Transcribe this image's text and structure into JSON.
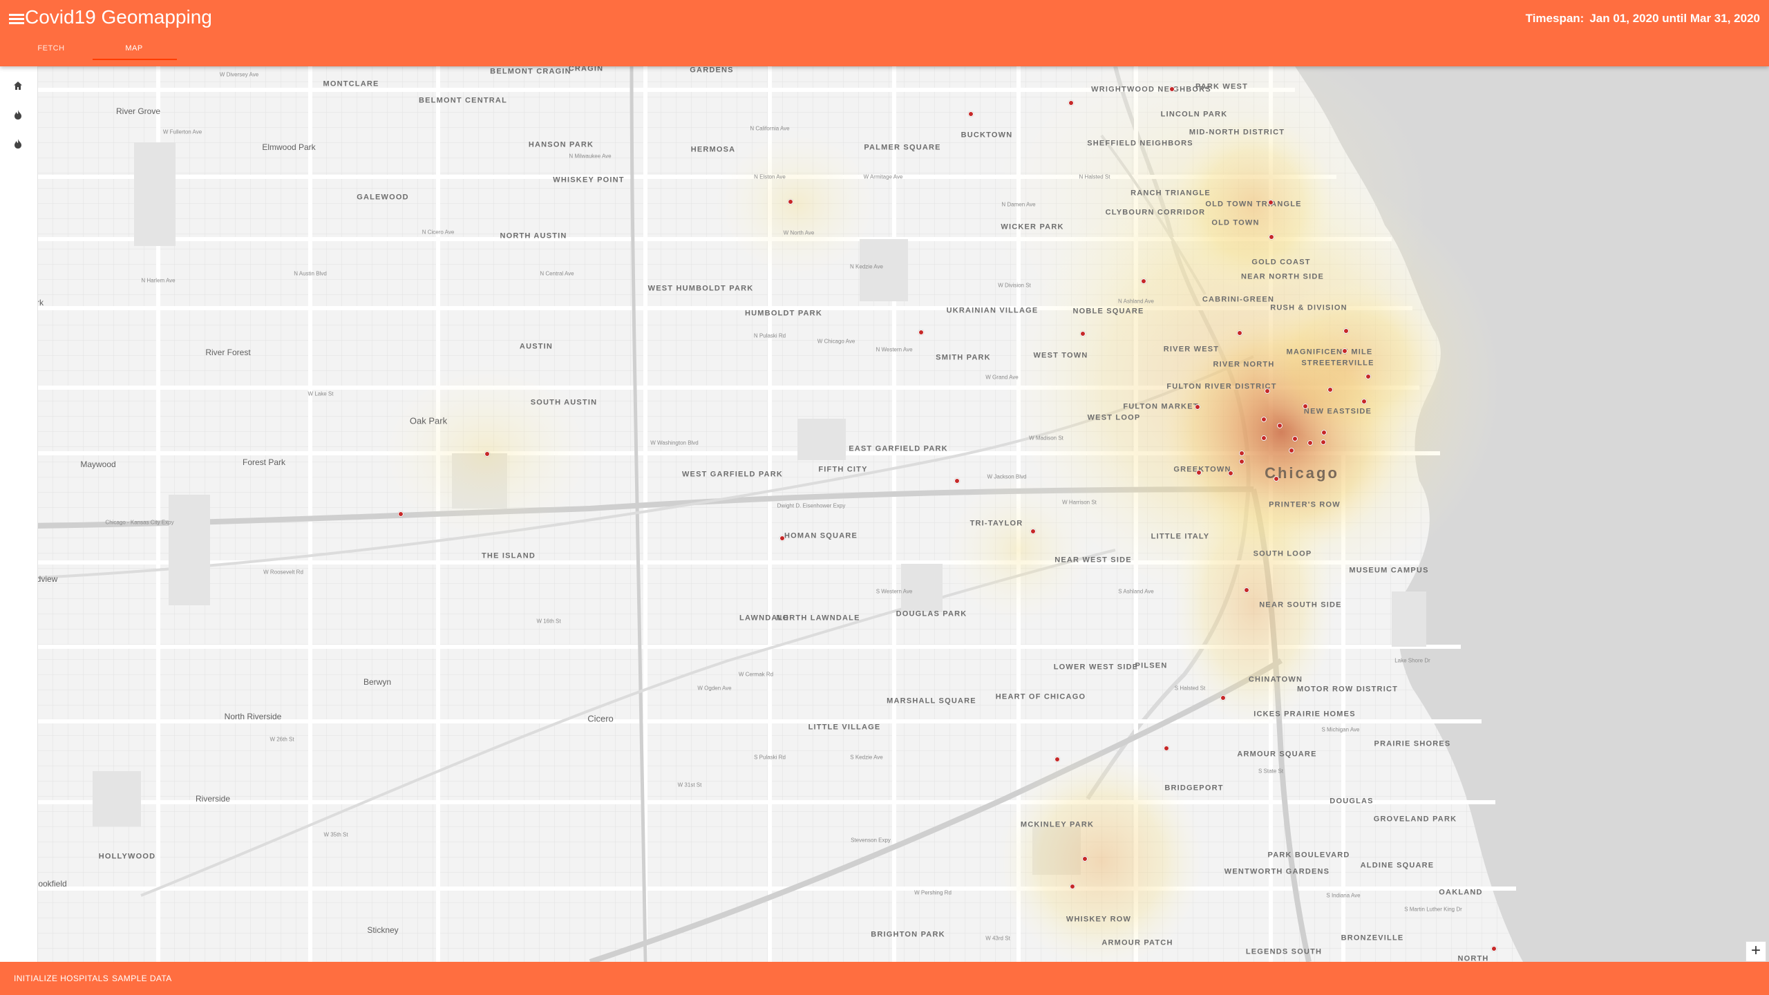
{
  "header": {
    "title": "Covid19 Geomapping",
    "timespan_label": "Timespan:",
    "timespan_value": "Jan 01, 2020 until Mar 31, 2020",
    "tabs": [
      {
        "label": "FETCH",
        "active": false
      },
      {
        "label": "MAP",
        "active": true
      }
    ]
  },
  "left_rail": {
    "items": [
      {
        "icon": "home-icon"
      },
      {
        "icon": "fire-icon"
      },
      {
        "icon": "fire-icon"
      }
    ]
  },
  "map": {
    "zoom_in_label": "+",
    "city_label": "Chicago",
    "neighborhoods": [
      "BELMONT CRAGIN",
      "CRAGIN",
      "GARDENS",
      "MONTCLARE",
      "BELMONT CENTRAL",
      "WRIGHTWOOD NEIGHBORS",
      "PARK WEST",
      "LINCOLN PARK",
      "MID-NORTH DISTRICT",
      "BUCKTOWN",
      "SHEFFIELD NEIGHBORS",
      "HERMOSA",
      "PALMER SQUARE",
      "HANSON PARK",
      "WHISKEY POINT",
      "RANCH TRIANGLE",
      "CLYBOURN CORRIDOR",
      "OLD TOWN TRIANGLE",
      "OLD TOWN",
      "GALEWOOD",
      "NORTH AUSTIN",
      "WICKER PARK",
      "GOLD COAST",
      "NEAR NORTH SIDE",
      "WEST HUMBOLDT PARK",
      "HUMBOLDT PARK",
      "UKRAINIAN VILLAGE",
      "NOBLE SQUARE",
      "CABRINI-GREEN",
      "RUSH & DIVISION",
      "AUSTIN",
      "SMITH PARK",
      "WEST TOWN",
      "RIVER WEST",
      "MAGNIFICENT MILE",
      "STREETERVILLE",
      "RIVER NORTH",
      "FULTON RIVER DISTRICT",
      "SOUTH AUSTIN",
      "FULTON MARKET",
      "NEW EASTSIDE",
      "WEST LOOP",
      "EAST GARFIELD PARK",
      "WEST GARFIELD PARK",
      "FIFTH CITY",
      "GREEKTOWN",
      "PRINTER'S ROW",
      "TRI-TAYLOR",
      "HOMAN SQUARE",
      "LITTLE ITALY",
      "THE ISLAND",
      "NEAR WEST SIDE",
      "SOUTH LOOP",
      "MUSEUM CAMPUS",
      "NEAR SOUTH SIDE",
      "LAWNDALE",
      "NORTH LAWNDALE",
      "DOUGLAS PARK",
      "LOWER WEST SIDE",
      "PILSEN",
      "CHINATOWN",
      "MOTOR ROW DISTRICT",
      "HEART OF CHICAGO",
      "MARSHALL SQUARE",
      "ICKES PRAIRIE HOMES",
      "LITTLE VILLAGE",
      "PRAIRIE SHORES",
      "ARMOUR SQUARE",
      "BRIDGEPORT",
      "DOUGLAS",
      "GROVELAND PARK",
      "MCKINLEY PARK",
      "PARK BOULEVARD",
      "WENTWORTH GARDENS",
      "ALDINE SQUARE",
      "WHISKEY ROW",
      "OAKLAND",
      "BRIGHTON PARK",
      "ARMOUR PATCH",
      "BRONZEVILLE",
      "LEGENDS SOUTH",
      "NORTH"
    ],
    "places": [
      "River Grove",
      "Elmwood Park",
      "Oak Park",
      "River Forest",
      "Forest Park",
      "Maywood",
      "Cicero",
      "Berwyn",
      "North Riverside",
      "Riverside",
      "HOLLYWOOD",
      "Stickney",
      "ookfield",
      "dview",
      "rk"
    ],
    "streets": [
      "W Diversey Ave",
      "W Fullerton Ave",
      "W Armitage Ave",
      "W North Ave",
      "W Division St",
      "W Chicago Ave",
      "W Grand Ave",
      "W Lake St",
      "W Madison St",
      "W Washington Blvd",
      "W Jackson Blvd",
      "W Harrison St",
      "W Roosevelt Rd",
      "W 16th St",
      "W Cermak Rd",
      "W 26th St",
      "W 31st St",
      "W 35th St",
      "W Pershing Rd",
      "W 43rd St",
      "Dwight D. Eisenhower Expy",
      "Chicago - Kansas City Expy",
      "Stevenson Expy",
      "N Pulaski Rd",
      "N Cicero Ave",
      "N Central Ave",
      "N Austin Blvd",
      "N Harlem Ave",
      "N Kedzie Ave",
      "N California Ave",
      "N Western Ave",
      "N Damen Ave",
      "N Ashland Ave",
      "N Halsted St",
      "S Pulaski Rd",
      "S Kedzie Ave",
      "S Western Ave",
      "S Ashland Ave",
      "S Halsted St",
      "S State St",
      "S Michigan Ave",
      "S Indiana Ave",
      "S Martin Luther King Dr",
      "W Ogden Ave",
      "N Milwaukee Ave",
      "N Elston Ave",
      "Lake Shore Dr"
    ]
  }
}
